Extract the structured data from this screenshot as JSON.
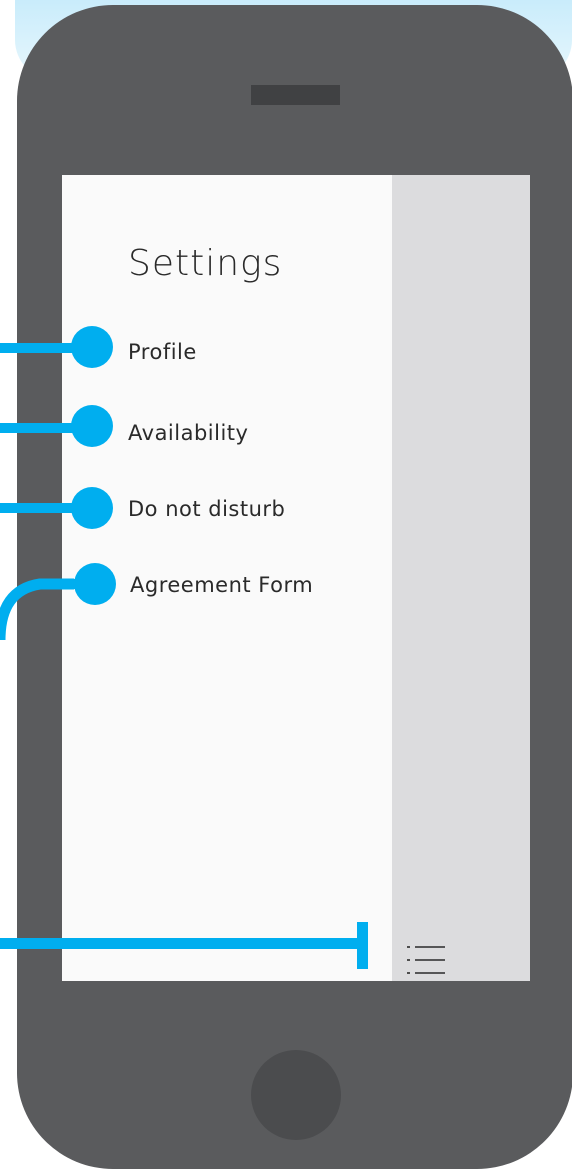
{
  "drawer": {
    "title": "Settings",
    "items": [
      {
        "label": "Profile"
      },
      {
        "label": "Availability"
      },
      {
        "label": "Do not disturb"
      },
      {
        "label": "Agreement Form"
      }
    ]
  },
  "icons": {
    "menu": "hamburger-menu-icon"
  },
  "colors": {
    "accent": "#00aeef",
    "phone_body": "#5a5b5d",
    "screen": "#fafafa",
    "gutter": "#dcdcde"
  }
}
